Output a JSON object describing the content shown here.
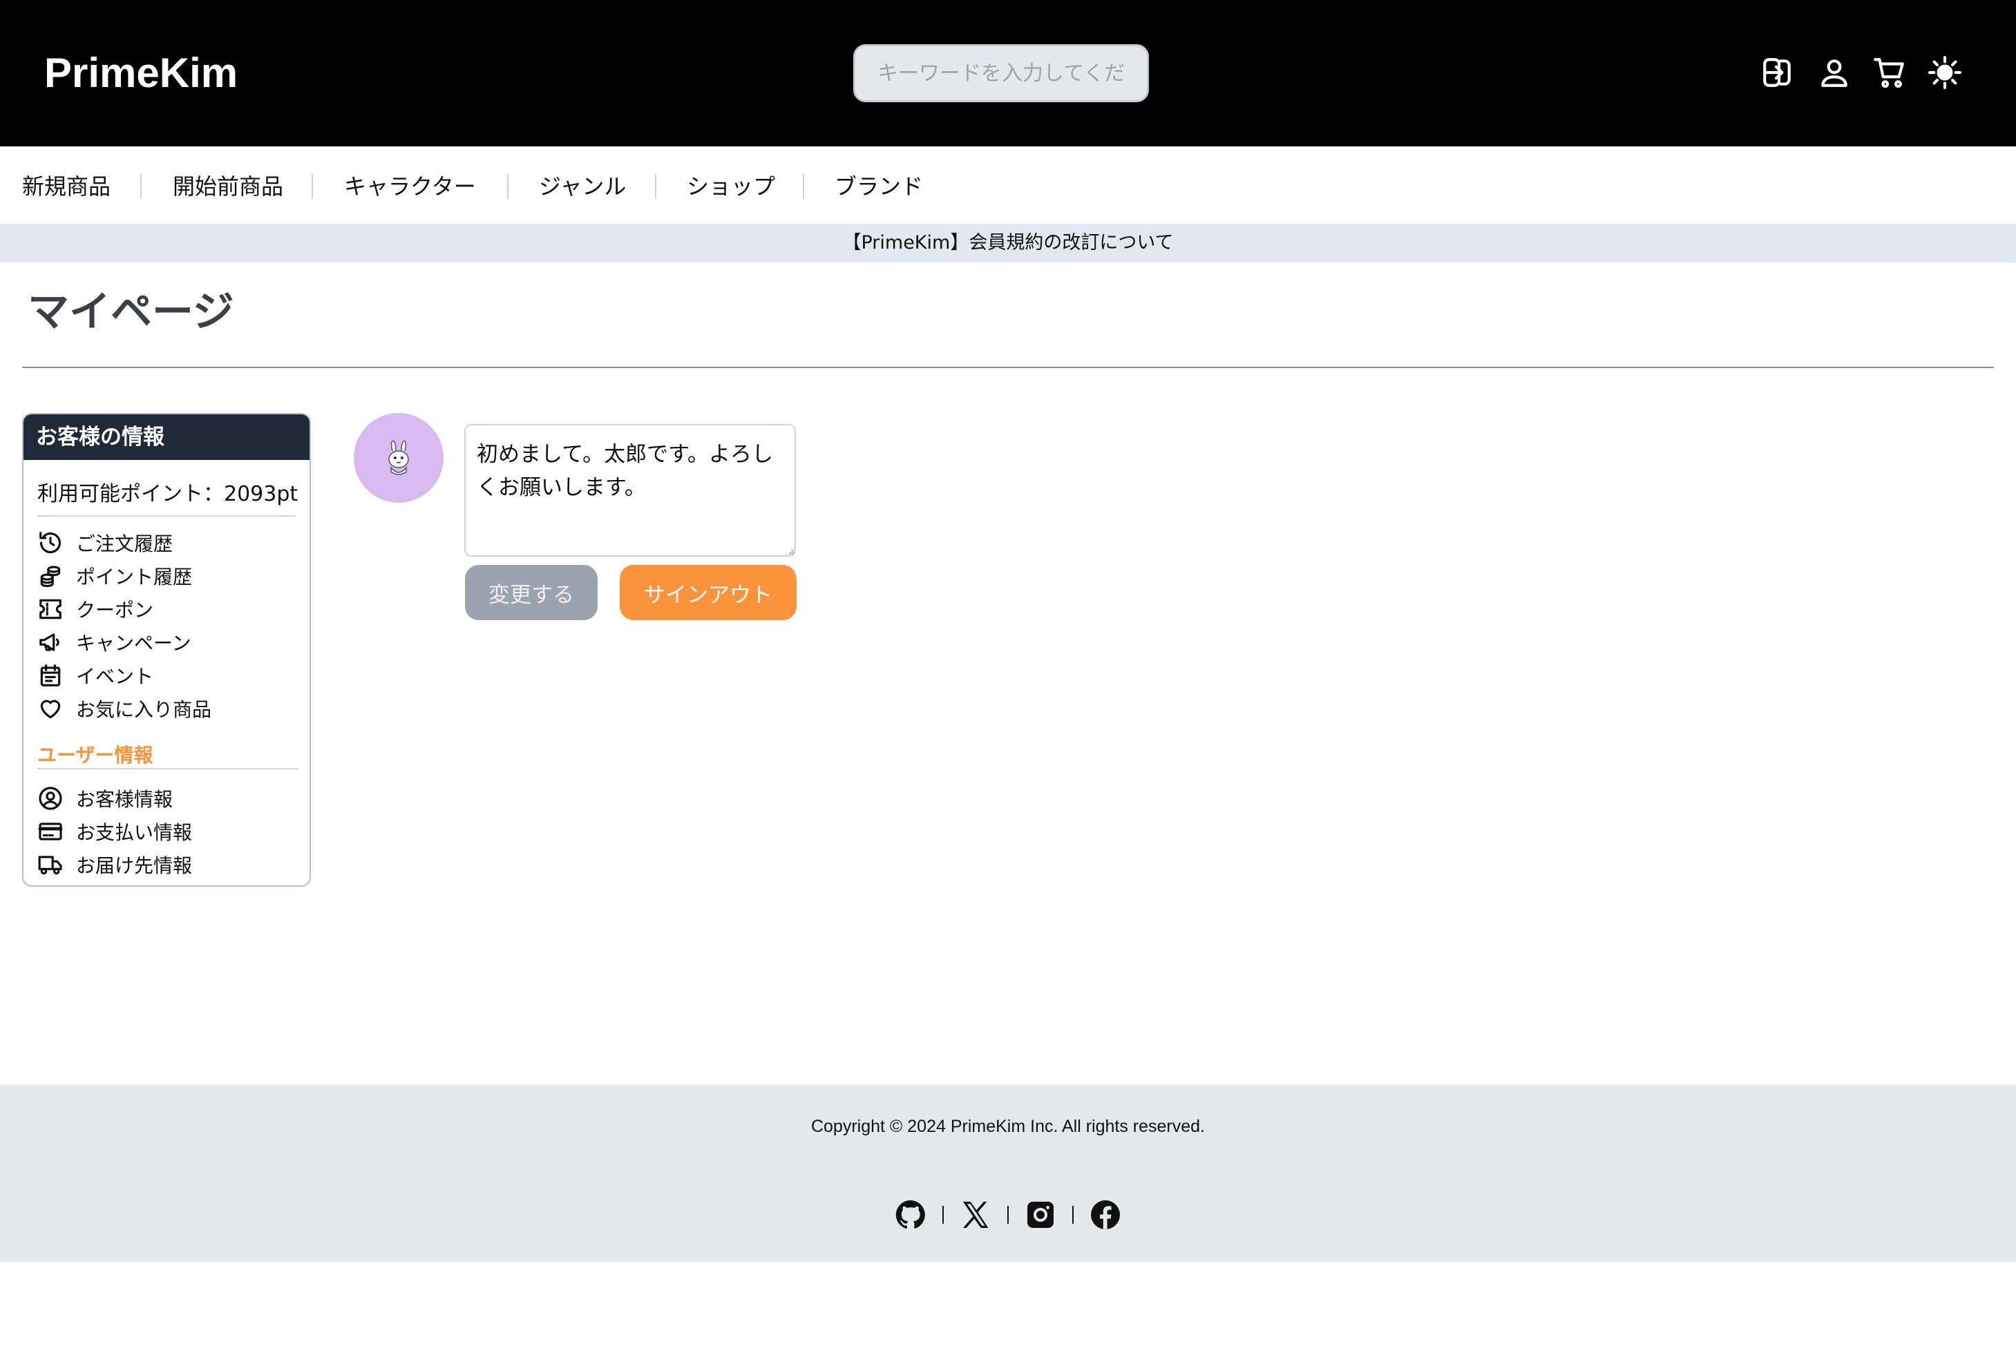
{
  "header": {
    "logo": "PrimeKim",
    "search_placeholder": "キーワードを入力してください",
    "icons": [
      "sign-in-icon",
      "user-icon",
      "cart-icon",
      "sun-icon"
    ]
  },
  "nav": {
    "categories": [
      "新規商品",
      "開始前商品",
      "キャラクター",
      "ジャンル",
      "ショップ",
      "ブランド"
    ]
  },
  "announcement": "【PrimeKim】会員規約の改訂について",
  "page": {
    "title": "マイページ"
  },
  "sidebar": {
    "heading": "お客様の情報",
    "points": "利用可能ポイント：2093pt",
    "items": [
      {
        "label": "ご注文履歴",
        "icon": "history-icon"
      },
      {
        "label": "ポイント履歴",
        "icon": "coins-icon"
      },
      {
        "label": "クーポン",
        "icon": "ticket-icon"
      },
      {
        "label": "キャンペーン",
        "icon": "megaphone-icon"
      },
      {
        "label": "イベント",
        "icon": "calendar-icon"
      },
      {
        "label": "お気に入り商品",
        "icon": "heart-icon"
      }
    ],
    "user_section_label": "ユーザー情報",
    "user_items": [
      {
        "label": "お客様情報",
        "icon": "user-circle-icon"
      },
      {
        "label": "お支払い情報",
        "icon": "credit-card-icon"
      },
      {
        "label": "お届け先情報",
        "icon": "truck-icon"
      }
    ]
  },
  "profile": {
    "avatar_color": "#d8b9f0",
    "bio": "初めまして。太郎です。よろしくお願いします。",
    "change_button": "変更する",
    "signout_button": "サインアウト"
  },
  "footer": {
    "copyright": "Copyright © 2024 PrimeKim Inc. All rights reserved.",
    "socials": [
      "github-icon",
      "x-icon",
      "instagram-icon",
      "facebook-icon"
    ]
  },
  "colors": {
    "header_bg": "#000000",
    "announce_bg": "#e2e8f0",
    "accent": "#fb923c",
    "sidebar_head_bg": "#1f2937",
    "footer_bg": "#e5e7eb"
  }
}
